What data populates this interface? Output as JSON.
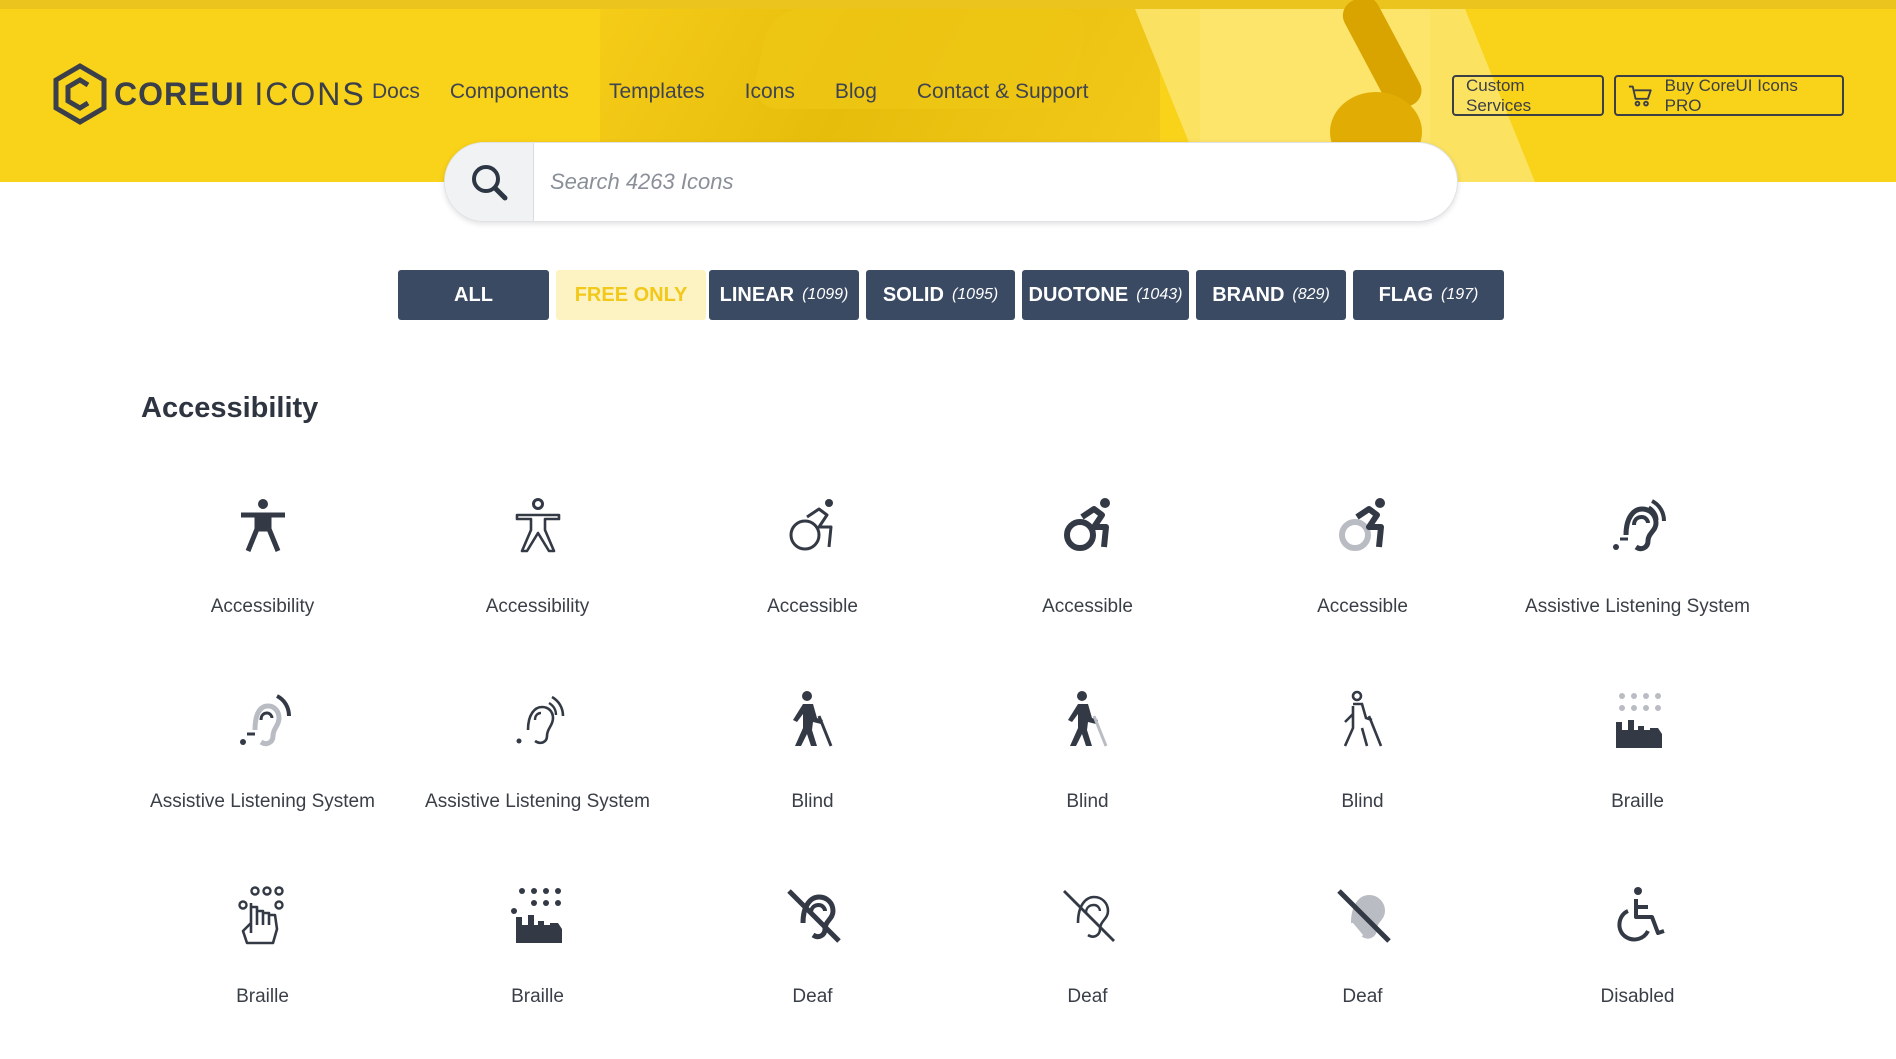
{
  "brand": {
    "name_bold": "COREUI",
    "name_thin": "ICONS"
  },
  "nav": {
    "items": [
      "Docs",
      "Components",
      "Templates",
      "Icons",
      "Blog",
      "Contact & Support"
    ]
  },
  "header_buttons": {
    "custom_services": "Custom Services",
    "buy_pro": "Buy CoreUI Icons PRO"
  },
  "search": {
    "placeholder": "Search 4263 Icons",
    "value": ""
  },
  "filters": [
    {
      "label": "ALL",
      "count": ""
    },
    {
      "label": "FREE ONLY",
      "count": ""
    },
    {
      "label": "LINEAR",
      "count": "(1099)"
    },
    {
      "label": "SOLID",
      "count": "(1095)"
    },
    {
      "label": "DUOTONE",
      "count": "(1043)"
    },
    {
      "label": "BRAND",
      "count": "(829)"
    },
    {
      "label": "FLAG",
      "count": "(197)"
    }
  ],
  "colors": {
    "hero_yellow": "#f9d21a",
    "filter_dark": "#3b4a63",
    "free_bg": "#fdf3c2",
    "free_text": "#f2c81a",
    "icon_dark": "#333a45"
  },
  "section": {
    "title": "Accessibility",
    "icons": [
      {
        "label": "Accessibility",
        "icon": "accessibility-solid-icon"
      },
      {
        "label": "Accessibility",
        "icon": "accessibility-linear-icon"
      },
      {
        "label": "Accessible",
        "icon": "accessible-linear-icon"
      },
      {
        "label": "Accessible",
        "icon": "accessible-solid-icon"
      },
      {
        "label": "Accessible",
        "icon": "accessible-duotone-icon"
      },
      {
        "label": "Assistive Listening System",
        "icon": "assistive-listening-solid-icon"
      },
      {
        "label": "Assistive Listening System",
        "icon": "assistive-listening-duotone-icon"
      },
      {
        "label": "Assistive Listening System",
        "icon": "assistive-listening-linear-icon"
      },
      {
        "label": "Blind",
        "icon": "blind-solid-icon"
      },
      {
        "label": "Blind",
        "icon": "blind-duotone-icon"
      },
      {
        "label": "Blind",
        "icon": "blind-linear-icon"
      },
      {
        "label": "Braille",
        "icon": "braille-duotone-icon"
      },
      {
        "label": "Braille",
        "icon": "braille-linear-icon"
      },
      {
        "label": "Braille",
        "icon": "braille-solid-icon"
      },
      {
        "label": "Deaf",
        "icon": "deaf-solid-icon"
      },
      {
        "label": "Deaf",
        "icon": "deaf-linear-icon"
      },
      {
        "label": "Deaf",
        "icon": "deaf-duotone-icon"
      },
      {
        "label": "Disabled",
        "icon": "disabled-icon"
      }
    ]
  }
}
